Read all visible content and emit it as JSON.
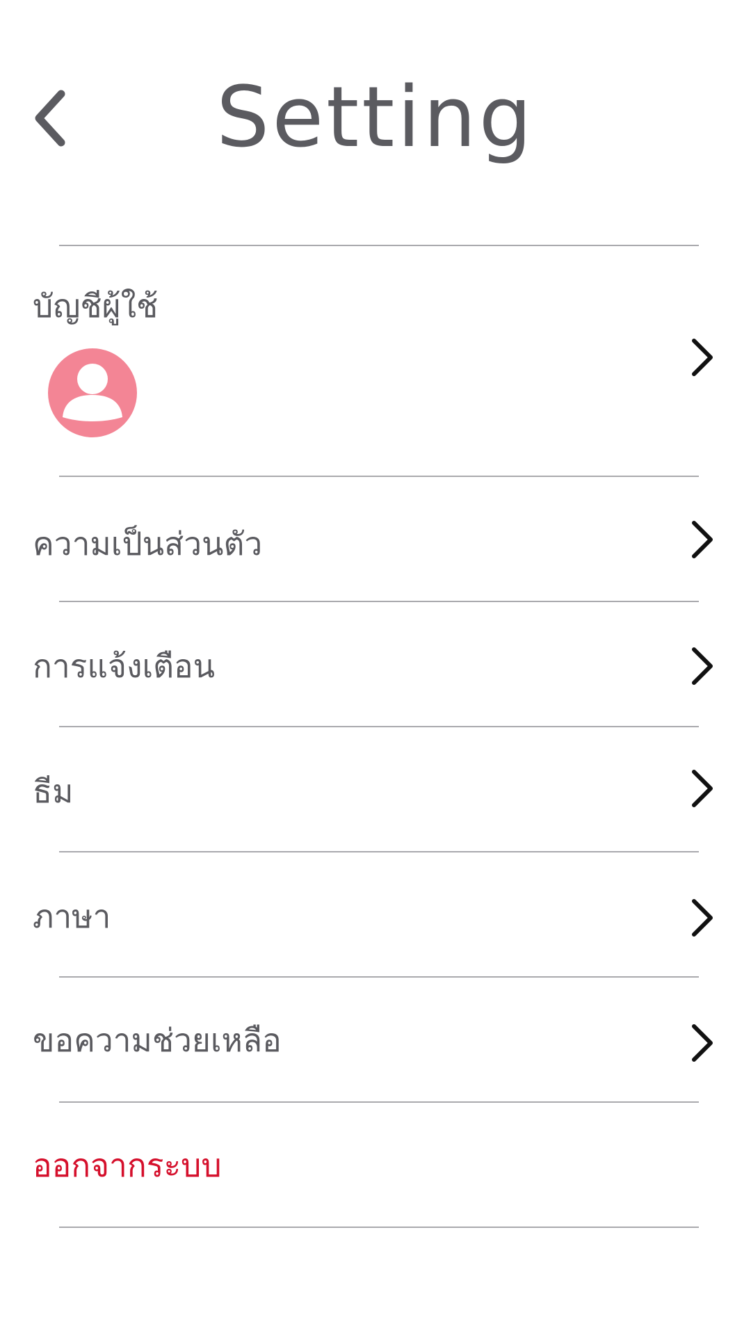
{
  "header": {
    "title": "Setting",
    "back_icon": "chevron-left-icon"
  },
  "account": {
    "label": "บัญชีผู้ใช้",
    "avatar_icon": "user-avatar-icon",
    "avatar_color": "#f38595"
  },
  "menu": [
    {
      "label": "ความเป็นส่วนตัว"
    },
    {
      "label": "การแจ้งเตือน"
    },
    {
      "label": "ธีม"
    },
    {
      "label": "ภาษา"
    },
    {
      "label": "ขอความช่วยเหลือ"
    }
  ],
  "logout": {
    "label": "ออกจากระบบ",
    "color": "#d5102c"
  },
  "colors": {
    "text": "#5a5a5f",
    "divider": "#a9a9ad",
    "chevron": "#111111"
  }
}
